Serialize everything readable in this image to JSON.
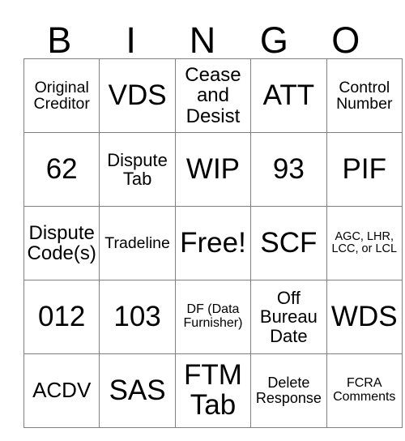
{
  "card": {
    "header_letters": [
      "B",
      "I",
      "N",
      "G",
      "O"
    ],
    "rows": [
      [
        {
          "text": "Original Creditor",
          "size": "fs-s"
        },
        {
          "text": "VDS",
          "size": "fs-xxl"
        },
        {
          "text": "Cease and Desist",
          "size": "fs-m"
        },
        {
          "text": "ATT",
          "size": "fs-xxl"
        },
        {
          "text": "Control Number",
          "size": "fs-s"
        }
      ],
      [
        {
          "text": "62",
          "size": "fs-xxl"
        },
        {
          "text": "Dispute Tab",
          "size": "fs-ms"
        },
        {
          "text": "WIP",
          "size": "fs-xxl"
        },
        {
          "text": "93",
          "size": "fs-xxl"
        },
        {
          "text": "PIF",
          "size": "fs-xxl"
        }
      ],
      [
        {
          "text": "Dispute Code(s)",
          "size": "fs-m"
        },
        {
          "text": "Tradeline",
          "size": "fs-s"
        },
        {
          "text": "Free!",
          "size": "fs-xxl"
        },
        {
          "text": "SCF",
          "size": "fs-xxl"
        },
        {
          "text": "AGC, LHR, LCC, or LCL",
          "size": "fs-tiny"
        }
      ],
      [
        {
          "text": "012",
          "size": "fs-xxl"
        },
        {
          "text": "103",
          "size": "fs-xxl"
        },
        {
          "text": "DF (Data Furnisher)",
          "size": "fs-xxs"
        },
        {
          "text": "Off Bureau Date",
          "size": "fs-ms"
        },
        {
          "text": "WDS",
          "size": "fs-xxl"
        }
      ],
      [
        {
          "text": "ACDV",
          "size": "fs-l"
        },
        {
          "text": "SAS",
          "size": "fs-xxl"
        },
        {
          "text": "FTM Tab",
          "size": "fs-xxl"
        },
        {
          "text": "Delete Response",
          "size": "fs-xs"
        },
        {
          "text": "FCRA Comments",
          "size": "fs-xxs"
        }
      ]
    ],
    "free_space_text": "Free!",
    "colors": {
      "background": "#ffffff",
      "text": "#000000",
      "border": "#808080"
    }
  }
}
